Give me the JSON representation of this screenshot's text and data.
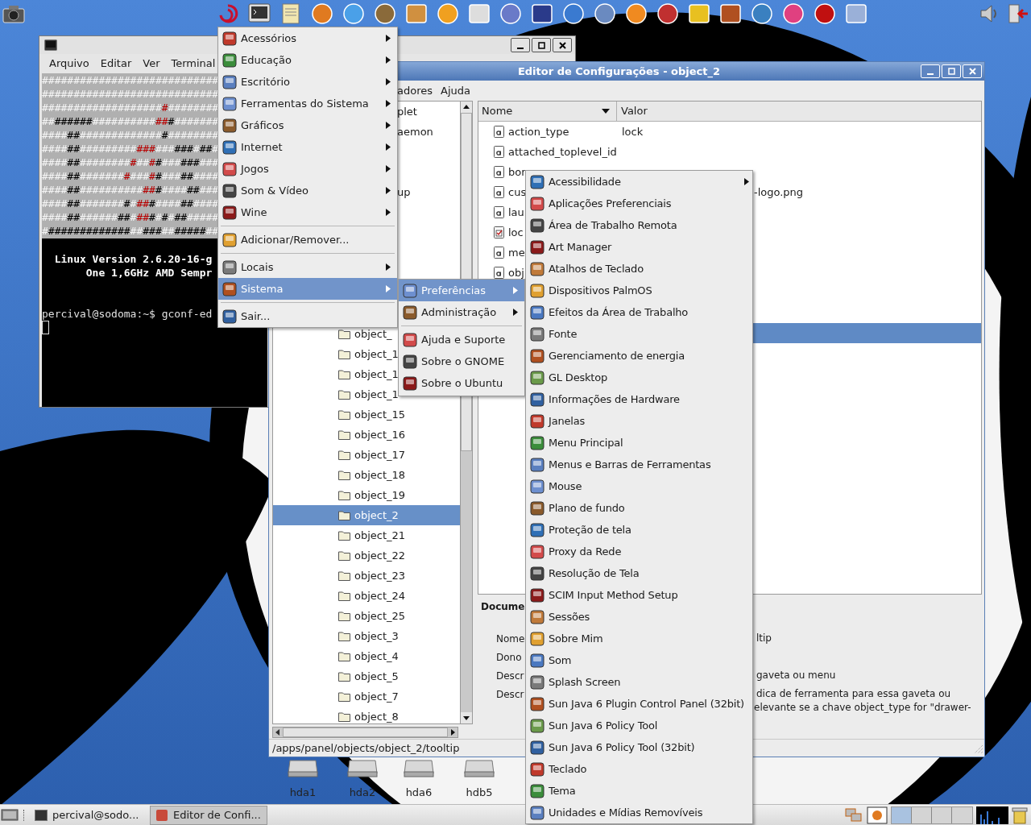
{
  "terminal": {
    "menus": [
      "Arquivo",
      "Editar",
      "Ver",
      "Terminal"
    ],
    "art_lines": [
      [
        {
          "kind": "light",
          "text": "############################"
        }
      ],
      [
        {
          "kind": "light",
          "text": "############################"
        }
      ],
      [
        {
          "kind": "light",
          "text": "###################"
        },
        {
          "kind": "red",
          "text": "#"
        },
        {
          "kind": "light",
          "text": "########"
        }
      ],
      [
        {
          "kind": "light",
          "text": "##"
        },
        {
          "kind": "dark",
          "text": "######"
        },
        {
          "kind": "light",
          "text": "##########"
        },
        {
          "kind": "red",
          "text": "##"
        },
        {
          "kind": "dark",
          "text": "#"
        },
        {
          "kind": "light",
          "text": "#######"
        }
      ],
      [
        {
          "kind": "light",
          "text": "####"
        },
        {
          "kind": "dark",
          "text": "##"
        },
        {
          "kind": "light",
          "text": "#############"
        },
        {
          "kind": "dark",
          "text": "#"
        },
        {
          "kind": "light",
          "text": "########"
        }
      ],
      [
        {
          "kind": "light",
          "text": "####"
        },
        {
          "kind": "dark",
          "text": "##"
        },
        {
          "kind": "light",
          "text": "#########"
        },
        {
          "kind": "red",
          "text": "###"
        },
        {
          "kind": "light",
          "text": "###"
        },
        {
          "kind": "dark",
          "text": "###"
        },
        {
          "kind": "light",
          "text": "#"
        },
        {
          "kind": "dark",
          "text": "##"
        },
        {
          "kind": "light",
          "text": "#"
        }
      ],
      [
        {
          "kind": "light",
          "text": "####"
        },
        {
          "kind": "dark",
          "text": "##"
        },
        {
          "kind": "light",
          "text": "########"
        },
        {
          "kind": "red",
          "text": "#"
        },
        {
          "kind": "light",
          "text": "##"
        },
        {
          "kind": "red",
          "text": "#"
        },
        {
          "kind": "dark",
          "text": "#"
        },
        {
          "kind": "light",
          "text": "###"
        },
        {
          "kind": "dark",
          "text": "###"
        },
        {
          "kind": "light",
          "text": "###"
        }
      ],
      [
        {
          "kind": "light",
          "text": "####"
        },
        {
          "kind": "dark",
          "text": "##"
        },
        {
          "kind": "light",
          "text": "#######"
        },
        {
          "kind": "red",
          "text": "#"
        },
        {
          "kind": "light",
          "text": "###"
        },
        {
          "kind": "red",
          "text": "#"
        },
        {
          "kind": "dark",
          "text": "#"
        },
        {
          "kind": "light",
          "text": "###"
        },
        {
          "kind": "dark",
          "text": "##"
        },
        {
          "kind": "light",
          "text": "####"
        }
      ],
      [
        {
          "kind": "light",
          "text": "####"
        },
        {
          "kind": "dark",
          "text": "##"
        },
        {
          "kind": "light",
          "text": "##########"
        },
        {
          "kind": "red",
          "text": "##"
        },
        {
          "kind": "dark",
          "text": "#"
        },
        {
          "kind": "light",
          "text": "####"
        },
        {
          "kind": "dark",
          "text": "##"
        },
        {
          "kind": "light",
          "text": "###"
        }
      ],
      [
        {
          "kind": "light",
          "text": "####"
        },
        {
          "kind": "dark",
          "text": "##"
        },
        {
          "kind": "light",
          "text": "#######"
        },
        {
          "kind": "dark",
          "text": "#"
        },
        {
          "kind": "light",
          "text": "#"
        },
        {
          "kind": "red",
          "text": "##"
        },
        {
          "kind": "dark",
          "text": "#"
        },
        {
          "kind": "light",
          "text": "####"
        },
        {
          "kind": "dark",
          "text": "##"
        },
        {
          "kind": "light",
          "text": "####"
        }
      ],
      [
        {
          "kind": "light",
          "text": "####"
        },
        {
          "kind": "dark",
          "text": "##"
        },
        {
          "kind": "light",
          "text": "######"
        },
        {
          "kind": "dark",
          "text": "##"
        },
        {
          "kind": "light",
          "text": "#"
        },
        {
          "kind": "red",
          "text": "##"
        },
        {
          "kind": "dark",
          "text": "#"
        },
        {
          "kind": "light",
          "text": "#"
        },
        {
          "kind": "dark",
          "text": "#"
        },
        {
          "kind": "light",
          "text": "#"
        },
        {
          "kind": "dark",
          "text": "##"
        },
        {
          "kind": "light",
          "text": "#####"
        }
      ],
      [
        {
          "kind": "light",
          "text": "#"
        },
        {
          "kind": "dark",
          "text": "#############"
        },
        {
          "kind": "light",
          "text": "##"
        },
        {
          "kind": "dark",
          "text": "###"
        },
        {
          "kind": "light",
          "text": "##"
        },
        {
          "kind": "dark",
          "text": "#####"
        },
        {
          "kind": "light",
          "text": "##"
        }
      ]
    ],
    "banner": [
      "  Linux Version 2.6.20-16-g",
      "       One 1,6GHz AMD Sempr"
    ],
    "prompt": "percival@sodoma:~$ gconf-ed"
  },
  "config_editor": {
    "title": "Editor de Configurações - object_2",
    "menus": [
      "adores",
      "Ajuda"
    ],
    "tree": {
      "fragments": [
        "plet",
        "aemon",
        "up"
      ],
      "rows": [
        {
          "label": "object_",
          "selected": false
        },
        {
          "label": "object_1",
          "selected": false
        },
        {
          "label": "object_1",
          "selected": false
        },
        {
          "label": "object_1",
          "selected": false
        },
        {
          "label": "object_15",
          "selected": false
        },
        {
          "label": "object_16",
          "selected": false
        },
        {
          "label": "object_17",
          "selected": false
        },
        {
          "label": "object_18",
          "selected": false
        },
        {
          "label": "object_19",
          "selected": false
        },
        {
          "label": "object_2",
          "selected": true
        },
        {
          "label": "object_21",
          "selected": false
        },
        {
          "label": "object_22",
          "selected": false
        },
        {
          "label": "object_23",
          "selected": false
        },
        {
          "label": "object_24",
          "selected": false
        },
        {
          "label": "object_25",
          "selected": false
        },
        {
          "label": "object_3",
          "selected": false
        },
        {
          "label": "object_4",
          "selected": false
        },
        {
          "label": "object_5",
          "selected": false
        },
        {
          "label": "object_7",
          "selected": false
        },
        {
          "label": "object_8",
          "selected": false
        }
      ]
    },
    "table": {
      "columns": [
        "Nome",
        "Valor"
      ],
      "rows": [
        {
          "name": "action_type",
          "value": "lock",
          "kind": "string",
          "selected": false
        },
        {
          "name": "attached_toplevel_id",
          "kind": "string",
          "selected": false
        },
        {
          "name": "bor",
          "kind": "string",
          "selected": false
        },
        {
          "name": "cus",
          "value_tail": "-logo.png",
          "kind": "string",
          "selected": false
        },
        {
          "name": "lau",
          "kind": "string",
          "selected": false
        },
        {
          "name": "loc",
          "kind": "bool",
          "selected": false
        },
        {
          "name": "me",
          "kind": "string",
          "selected": false
        },
        {
          "name": "obj",
          "kind": "string",
          "selected": false
        },
        {
          "selected": false
        },
        {
          "selected": false
        },
        {
          "selected": true
        }
      ]
    },
    "docs": {
      "heading": "Docume",
      "fields": [
        {
          "label": "Nome",
          "value": "ltip"
        },
        {
          "label": "Dono"
        },
        {
          "label": "Descr",
          "value": "gaveta ou menu"
        },
        {
          "label": "Descr",
          "value": "dica de ferramenta para essa gaveta ou",
          "continuation": "elevante se a chave object_type for \"drawer-"
        }
      ]
    },
    "status": "/apps/panel/objects/object_2/tooltip"
  },
  "desktop_icons": [
    {
      "label": "hda1"
    },
    {
      "label": "hda2"
    },
    {
      "label": "hda6"
    },
    {
      "label": "hdb5"
    }
  ],
  "taskbar": {
    "tasks": [
      {
        "label": "percival@sodo...",
        "selected": false
      },
      {
        "label": "Editor de Confi...",
        "selected": true
      }
    ]
  },
  "main_menu": {
    "items": [
      {
        "kind": "item",
        "label": "Acessórios",
        "submenu": true,
        "selected": false
      },
      {
        "kind": "item",
        "label": "Educação",
        "submenu": true,
        "selected": false
      },
      {
        "kind": "item",
        "label": "Escritório",
        "submenu": true,
        "selected": false
      },
      {
        "kind": "item",
        "label": "Ferramentas do Sistema",
        "submenu": true,
        "selected": false
      },
      {
        "kind": "item",
        "label": "Gráficos",
        "submenu": true,
        "selected": false
      },
      {
        "kind": "item",
        "label": "Internet",
        "submenu": true,
        "selected": false
      },
      {
        "kind": "item",
        "label": "Jogos",
        "submenu": true,
        "selected": false
      },
      {
        "kind": "item",
        "label": "Som & Vídeo",
        "submenu": true,
        "selected": false
      },
      {
        "kind": "item",
        "label": "Wine",
        "submenu": true,
        "selected": false
      },
      {
        "kind": "separator"
      },
      {
        "kind": "item",
        "label": "Adicionar/Remover...",
        "submenu": false,
        "selected": false
      },
      {
        "kind": "separator"
      },
      {
        "kind": "item",
        "label": "Locais",
        "submenu": true,
        "selected": false
      },
      {
        "kind": "item",
        "label": "Sistema",
        "submenu": true,
        "selected": true
      },
      {
        "kind": "separator"
      },
      {
        "kind": "item",
        "label": "Sair...",
        "submenu": false,
        "selected": false
      }
    ]
  },
  "system_menu": {
    "items": [
      {
        "kind": "item",
        "label": "Preferências",
        "submenu": true,
        "selected": true
      },
      {
        "kind": "item",
        "label": "Administração",
        "submenu": true,
        "selected": false
      },
      {
        "kind": "separator"
      },
      {
        "kind": "item",
        "label": "Ajuda e Suporte",
        "submenu": false,
        "selected": false
      },
      {
        "kind": "item",
        "label": "Sobre o GNOME",
        "submenu": false,
        "selected": false
      },
      {
        "kind": "item",
        "label": "Sobre o Ubuntu",
        "submenu": false,
        "selected": false
      }
    ]
  },
  "preferences_menu": {
    "items": [
      {
        "kind": "item",
        "label": "Acessibilidade",
        "submenu": true,
        "selected": false
      },
      {
        "kind": "item",
        "label": "Aplicações Preferenciais",
        "submenu": false,
        "selected": false
      },
      {
        "kind": "item",
        "label": "Área de Trabalho Remota",
        "submenu": false,
        "selected": false
      },
      {
        "kind": "item",
        "label": "Art Manager",
        "submenu": false,
        "selected": false
      },
      {
        "kind": "item",
        "label": "Atalhos de Teclado",
        "submenu": false,
        "selected": false
      },
      {
        "kind": "item",
        "label": "Dispositivos PalmOS",
        "submenu": false,
        "selected": false
      },
      {
        "kind": "item",
        "label": "Efeitos da Área de Trabalho",
        "submenu": false,
        "selected": false
      },
      {
        "kind": "item",
        "label": "Fonte",
        "submenu": false,
        "selected": false
      },
      {
        "kind": "item",
        "label": "Gerenciamento de energia",
        "submenu": false,
        "selected": false
      },
      {
        "kind": "item",
        "label": "GL Desktop",
        "submenu": false,
        "selected": false
      },
      {
        "kind": "item",
        "label": "Informações de Hardware",
        "submenu": false,
        "selected": false
      },
      {
        "kind": "item",
        "label": "Janelas",
        "submenu": false,
        "selected": false
      },
      {
        "kind": "item",
        "label": "Menu Principal",
        "submenu": false,
        "selected": false
      },
      {
        "kind": "item",
        "label": "Menus e Barras de Ferramentas",
        "submenu": false,
        "selected": false
      },
      {
        "kind": "item",
        "label": "Mouse",
        "submenu": false,
        "selected": false
      },
      {
        "kind": "item",
        "label": "Plano de fundo",
        "submenu": false,
        "selected": false
      },
      {
        "kind": "item",
        "label": "Proteção de tela",
        "submenu": false,
        "selected": false
      },
      {
        "kind": "item",
        "label": "Proxy da Rede",
        "submenu": false,
        "selected": false
      },
      {
        "kind": "item",
        "label": "Resolução de Tela",
        "submenu": false,
        "selected": false
      },
      {
        "kind": "item",
        "label": "SCIM Input Method Setup",
        "submenu": false,
        "selected": false
      },
      {
        "kind": "item",
        "label": "Sessões",
        "submenu": false,
        "selected": false
      },
      {
        "kind": "item",
        "label": "Sobre Mim",
        "submenu": false,
        "selected": false
      },
      {
        "kind": "item",
        "label": "Som",
        "submenu": false,
        "selected": false
      },
      {
        "kind": "item",
        "label": "Splash Screen",
        "submenu": false,
        "selected": false
      },
      {
        "kind": "item",
        "label": "Sun Java 6 Plugin Control Panel (32bit)",
        "submenu": false,
        "selected": false
      },
      {
        "kind": "item",
        "label": "Sun Java 6 Policy Tool",
        "submenu": false,
        "selected": false
      },
      {
        "kind": "item",
        "label": "Sun Java 6 Policy Tool (32bit)",
        "submenu": false,
        "selected": false
      },
      {
        "kind": "item",
        "label": "Teclado",
        "submenu": false,
        "selected": false
      },
      {
        "kind": "item",
        "label": "Tema",
        "submenu": false,
        "selected": false
      },
      {
        "kind": "item",
        "label": "Unidades e Mídias Removíveis",
        "submenu": false,
        "selected": false
      }
    ]
  }
}
